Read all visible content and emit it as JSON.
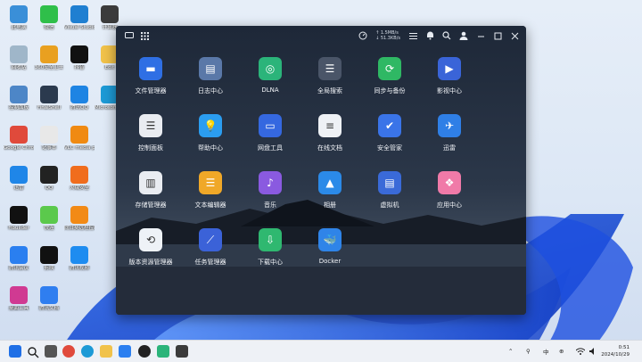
{
  "desktop": {
    "icons": [
      {
        "label": "此电脑",
        "color": "#3a8fd8"
      },
      {
        "label": "微信",
        "color": "#2fbf4a"
      },
      {
        "label": "Visual Studio Code",
        "color": "#1f7fd1"
      },
      {
        "label": "计算器",
        "color": "#3b3b3b"
      },
      {
        "label": "回收站",
        "color": "#9fb6c9"
      },
      {
        "label": "360安全卫士",
        "color": "#e9a020"
      },
      {
        "label": "抖音",
        "color": "#111111"
      },
      {
        "label": "Edit",
        "color": "#f1c24a"
      },
      {
        "label": "控制面板",
        "color": "#4d86c7"
      },
      {
        "label": "FinalShell",
        "color": "#2b3a4e"
      },
      {
        "label": "腾讯QQ",
        "color": "#1e84e3"
      },
      {
        "label": "Microsoft Edge",
        "color": "#1d9ad6"
      },
      {
        "label": "Google Chrome",
        "color": "#e04a3b"
      },
      {
        "label": "记事本",
        "color": "#e8e8e8"
      },
      {
        "label": "VLC media player",
        "color": "#f08a12"
      },
      {
        "label": "迅雷",
        "color": "#1f86e8"
      },
      {
        "label": "QQ",
        "color": "#222222"
      },
      {
        "label": "火绒安全",
        "color": "#f06d1d"
      },
      {
        "label": "Hbuilder",
        "color": "#111111"
      },
      {
        "label": "快连",
        "color": "#5bc94c"
      },
      {
        "label": "向日葵远程控制",
        "color": "#f28a16"
      },
      {
        "label": "腾讯会议",
        "color": "#2a7ff0"
      },
      {
        "label": "剪映",
        "color": "#111111"
      },
      {
        "label": "腾讯视频",
        "color": "#1e8cf0"
      },
      {
        "label": "桌面工具",
        "color": "#d03a92"
      },
      {
        "label": "腾讯文档",
        "color": "#2f7ef0"
      }
    ]
  },
  "nas": {
    "network": {
      "up": "↑ 1.5MB/s",
      "down": "↓ 51.3KB/s"
    },
    "apps": [
      {
        "name": "文件管理器",
        "bg": "#2f6fe4",
        "glyph": "▬"
      },
      {
        "name": "日志中心",
        "bg": "#5a78a8",
        "glyph": "▤"
      },
      {
        "name": "DLNA",
        "bg": "#2bb47a",
        "glyph": "◎"
      },
      {
        "name": "全局搜索",
        "bg": "#4a5568",
        "glyph": "☰"
      },
      {
        "name": "同步与备份",
        "bg": "#2fb864",
        "glyph": "⟳"
      },
      {
        "name": "影视中心",
        "bg": "#3a64d8",
        "glyph": "▶"
      },
      {
        "name": "控制面板",
        "bg": "#e9ecf1",
        "glyph": "☰"
      },
      {
        "name": "帮助中心",
        "bg": "#2b9df0",
        "glyph": "💡"
      },
      {
        "name": "网盘工具",
        "bg": "#3568e0",
        "glyph": "▭"
      },
      {
        "name": "在线文档",
        "bg": "#eef1f5",
        "glyph": "≡"
      },
      {
        "name": "安全管家",
        "bg": "#3a74e8",
        "glyph": "✔"
      },
      {
        "name": "迅雷",
        "bg": "#2f7fe6",
        "glyph": "✈"
      },
      {
        "name": "存储管理器",
        "bg": "#e9ecf1",
        "glyph": "▥"
      },
      {
        "name": "文本编辑器",
        "bg": "#f0a828",
        "glyph": "☰"
      },
      {
        "name": "音乐",
        "bg": "#8a5ae0",
        "glyph": "♪"
      },
      {
        "name": "相册",
        "bg": "#2b8ae8",
        "glyph": "▲"
      },
      {
        "name": "虚拟机",
        "bg": "#3a6ad8",
        "glyph": "▤"
      },
      {
        "name": "应用中心",
        "bg": "#f07aa8",
        "glyph": "❖"
      },
      {
        "name": "版本资源管理器",
        "bg": "#eef2f7",
        "glyph": "⟲"
      },
      {
        "name": "任务管理器",
        "bg": "#3b62d8",
        "glyph": "⟋"
      },
      {
        "name": "下载中心",
        "bg": "#2fb870",
        "glyph": "⇩"
      },
      {
        "name": "Docker",
        "bg": "#2f84e8",
        "glyph": "🐳"
      }
    ]
  },
  "taskbar": {
    "tray": {
      "lang": "中",
      "ime": "⊕"
    },
    "clock": {
      "time": "0:51",
      "date": "2024/10/29"
    }
  }
}
